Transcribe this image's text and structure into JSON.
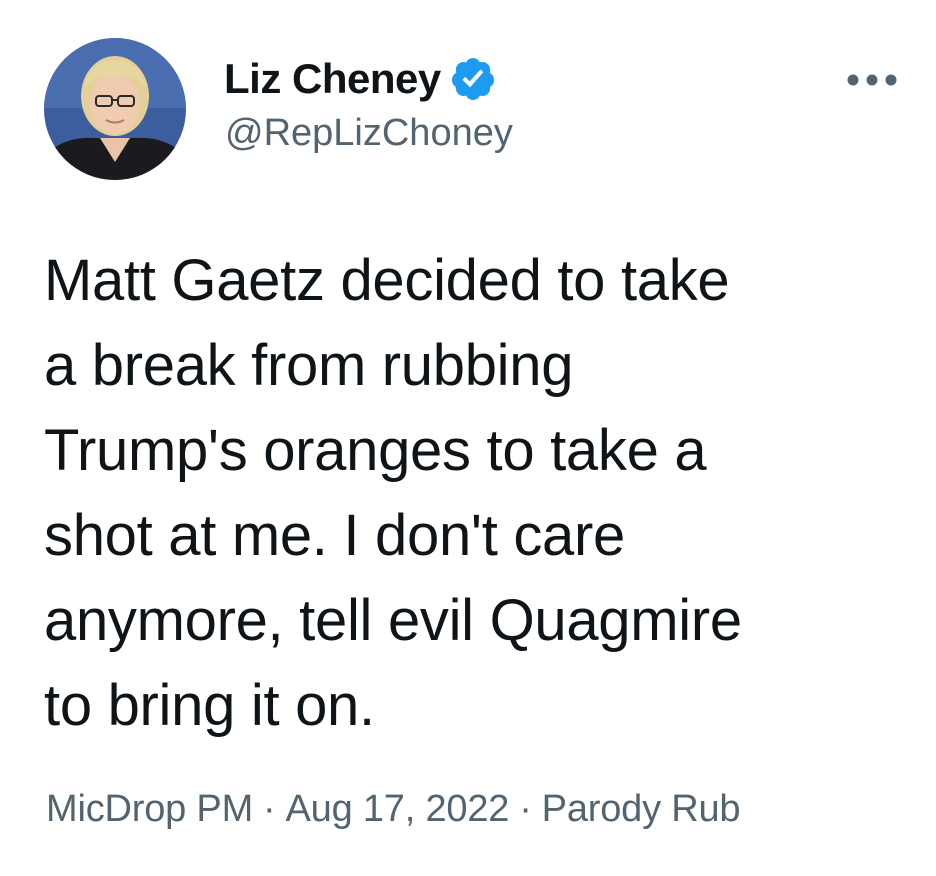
{
  "tweet": {
    "author": {
      "display_name": "Liz Cheney",
      "handle": "@RepLizChoney",
      "verified": true,
      "avatar_icon": "profile-photo"
    },
    "more_icon": "ellipsis-icon",
    "text": "Matt Gaetz decided to take\na break from rubbing\nTrump's oranges to take a\nshot at me. I don't care\nanymore, tell evil Quagmire\nto bring it on.",
    "meta": {
      "time": "MicDrop PM",
      "separator": "·",
      "date": "Aug 17, 2022",
      "source": "Parody Rub"
    }
  },
  "colors": {
    "text": "#0f1419",
    "secondary": "#536471",
    "verified_blue": "#1d9bf0",
    "background": "#ffffff"
  }
}
